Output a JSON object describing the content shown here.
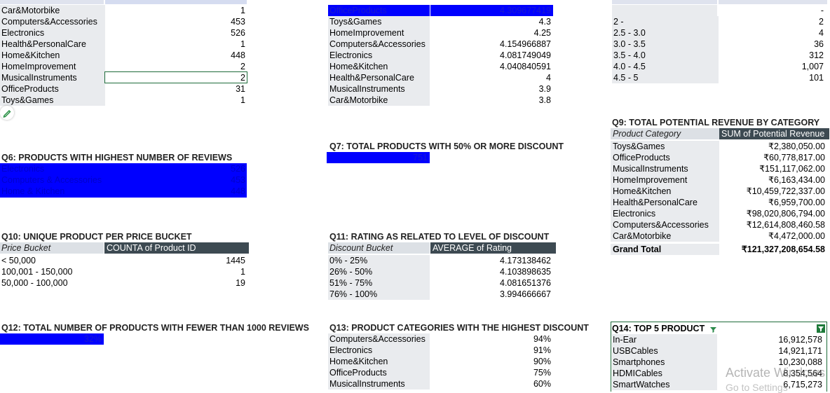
{
  "block_a": {
    "rows": [
      {
        "label": "Car&Motorbike",
        "value": "1"
      },
      {
        "label": "Computers&Accessories",
        "value": "453"
      },
      {
        "label": "Electronics",
        "value": "526"
      },
      {
        "label": "Health&PersonalCare",
        "value": "1"
      },
      {
        "label": "Home&Kitchen",
        "value": "448"
      },
      {
        "label": "HomeImprovement",
        "value": "2"
      },
      {
        "label": "MusicalInstruments",
        "value": "2"
      },
      {
        "label": "OfficeProducts",
        "value": "31"
      },
      {
        "label": "Toys&Games",
        "value": "1"
      }
    ]
  },
  "block_b": {
    "rows": [
      {
        "label": "OfficeProducts",
        "value": "4.309677419"
      },
      {
        "label": "Toys&Games",
        "value": "4.3"
      },
      {
        "label": "HomeImprovement",
        "value": "4.25"
      },
      {
        "label": "Computers&Accessories",
        "value": "4.154966887"
      },
      {
        "label": "Electronics",
        "value": "4.081749049"
      },
      {
        "label": "Home&Kitchen",
        "value": "4.040840591"
      },
      {
        "label": "Health&PersonalCare",
        "value": "4"
      },
      {
        "label": "MusicalInstruments",
        "value": "3.9"
      },
      {
        "label": "Car&Motorbike",
        "value": "3.8"
      }
    ]
  },
  "block_c": {
    "top_value": "-",
    "rows": [
      {
        "label": "2 -",
        "value": "2"
      },
      {
        "label": "2.5 - 3.0",
        "value": "4"
      },
      {
        "label": "3.0 - 3.5",
        "value": "36"
      },
      {
        "label": "3.5 - 4.0",
        "value": "312"
      },
      {
        "label": "4.0 - 4.5",
        "value": "1,007"
      },
      {
        "label": "4.5 - 5",
        "value": "101"
      }
    ]
  },
  "q6": {
    "title": "Q6: PRODUCTS WITH HIGHEST NUMBER OF REVIEWS",
    "rows": [
      {
        "label": "Electronics",
        "value": "526"
      },
      {
        "label": "Computers & Accessories",
        "value": "453"
      },
      {
        "label": "Home & Kitchen",
        "value": "448"
      }
    ]
  },
  "q7": {
    "title": "Q7: TOTAL PRODUCTS WITH 50% OR MORE DISCOUNT",
    "value": "751"
  },
  "q9": {
    "title": "Q9: TOTAL POTENTIAL REVENUE BY CATEGORY",
    "col1": "Product Category",
    "col2": "SUM of Potential Revenue",
    "rows": [
      {
        "label": "Toys&Games",
        "value": "₹2,380,050.00"
      },
      {
        "label": "OfficeProducts",
        "value": "₹60,778,817.00"
      },
      {
        "label": "MusicalInstruments",
        "value": "₹151,117,062.00"
      },
      {
        "label": "HomeImprovement",
        "value": "₹6,163,434.00"
      },
      {
        "label": "Home&Kitchen",
        "value": "₹10,459,722,337.00"
      },
      {
        "label": "Health&PersonalCare",
        "value": "₹6,959,700.00"
      },
      {
        "label": "Electronics",
        "value": "₹98,020,806,794.00"
      },
      {
        "label": "Computers&Accessories",
        "value": "₹12,614,808,460.58"
      },
      {
        "label": "Car&Motorbike",
        "value": "₹4,472,000.00"
      }
    ],
    "total_label": "Grand Total",
    "total_value": "₹121,327,208,654.58"
  },
  "q10": {
    "title": "Q10: UNIQUE PRODUCT PER PRICE BUCKET",
    "col1": "Price Bucket",
    "col2": "COUNTA of Product ID",
    "rows": [
      {
        "label": "< 50,000",
        "value": "1445"
      },
      {
        "label": "100,001 - 150,000",
        "value": "1"
      },
      {
        "label": "50,000 - 100,000",
        "value": "19"
      }
    ]
  },
  "q11": {
    "title": "Q11: RATING AS RELATED TO LEVEL OF DISCOUNT",
    "col1": "Discount Bucket",
    "col2": "AVERAGE of Rating",
    "rows": [
      {
        "label": "0% - 25%",
        "value": "4.173138462"
      },
      {
        "label": "26% - 50%",
        "value": "4.103898635"
      },
      {
        "label": "51% - 75%",
        "value": "4.081651376"
      },
      {
        "label": "76% - 100%",
        "value": "3.994666667"
      }
    ]
  },
  "q12": {
    "title": "Q12: TOTAL NUMBER OF PRODUCTS WITH FEWER THAN 1000 REVIEWS",
    "value": "32%"
  },
  "q13": {
    "title": "Q13: PRODUCT CATEGORIES WITH THE HIGHEST DISCOUNT",
    "rows": [
      {
        "label": "Computers&Accessories",
        "value": "94%"
      },
      {
        "label": "Electronics",
        "value": "91%"
      },
      {
        "label": "Home&Kitchen",
        "value": "90%"
      },
      {
        "label": "OfficeProducts",
        "value": "75%"
      },
      {
        "label": "MusicalInstruments",
        "value": "60%"
      }
    ]
  },
  "q14": {
    "title": "Q14: TOP 5 PRODUCT",
    "rows": [
      {
        "label": "In-Ear",
        "value": "16,912,578"
      },
      {
        "label": "USBCables",
        "value": "14,921,171"
      },
      {
        "label": "Smartphones",
        "value": "10,230,088"
      },
      {
        "label": "HDMICables",
        "value": "8,354,564"
      },
      {
        "label": "SmartWatches",
        "value": "6,715,273"
      }
    ]
  },
  "watermark": {
    "line1": "Activate Windows",
    "line2": "Go to Settings"
  },
  "colors": {
    "highlight_blue": "#0000ff",
    "header_dark": "#3d4a52",
    "label_gray": "#e9ebee",
    "selection_green": "#1e6b3a"
  }
}
